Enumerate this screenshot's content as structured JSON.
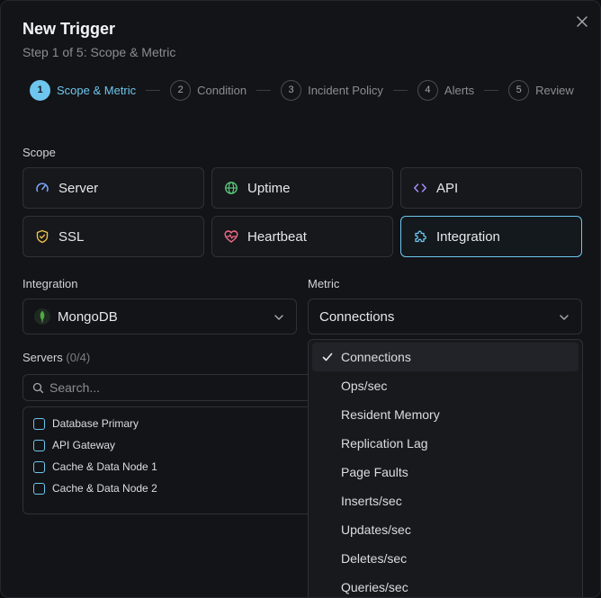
{
  "dialog": {
    "title": "New Trigger",
    "subtitle": "Step 1 of 5: Scope & Metric"
  },
  "steps": [
    {
      "num": "1",
      "label": "Scope & Metric",
      "active": true
    },
    {
      "num": "2",
      "label": "Condition",
      "active": false
    },
    {
      "num": "3",
      "label": "Incident Policy",
      "active": false
    },
    {
      "num": "4",
      "label": "Alerts",
      "active": false
    },
    {
      "num": "5",
      "label": "Review",
      "active": false
    }
  ],
  "scope": {
    "label": "Scope",
    "options": [
      {
        "label": "Server",
        "icon": "gauge-icon",
        "selected": false
      },
      {
        "label": "Uptime",
        "icon": "globe-icon",
        "selected": false
      },
      {
        "label": "API",
        "icon": "code-icon",
        "selected": false
      },
      {
        "label": "SSL",
        "icon": "shield-icon",
        "selected": false
      },
      {
        "label": "Heartbeat",
        "icon": "heart-pulse-icon",
        "selected": false
      },
      {
        "label": "Integration",
        "icon": "puzzle-icon",
        "selected": true
      }
    ]
  },
  "integration": {
    "label": "Integration",
    "value": "MongoDB",
    "icon": "mongodb-leaf-icon"
  },
  "metric": {
    "label": "Metric",
    "value": "Connections",
    "options": [
      "Connections",
      "Ops/sec",
      "Resident Memory",
      "Replication Lag",
      "Page Faults",
      "Inserts/sec",
      "Updates/sec",
      "Deletes/sec",
      "Queries/sec"
    ],
    "selected_index": 0
  },
  "servers": {
    "label": "Servers",
    "count": "(0/4)",
    "search_placeholder": "Search...",
    "items": [
      "Database Primary",
      "API Gateway",
      "Cache & Data Node 1",
      "Cache & Data Node 2"
    ]
  },
  "colors": {
    "accent": "#6ec6ee",
    "background": "#131417",
    "border": "#2f3137",
    "mongodb_green": "#4faa41"
  }
}
